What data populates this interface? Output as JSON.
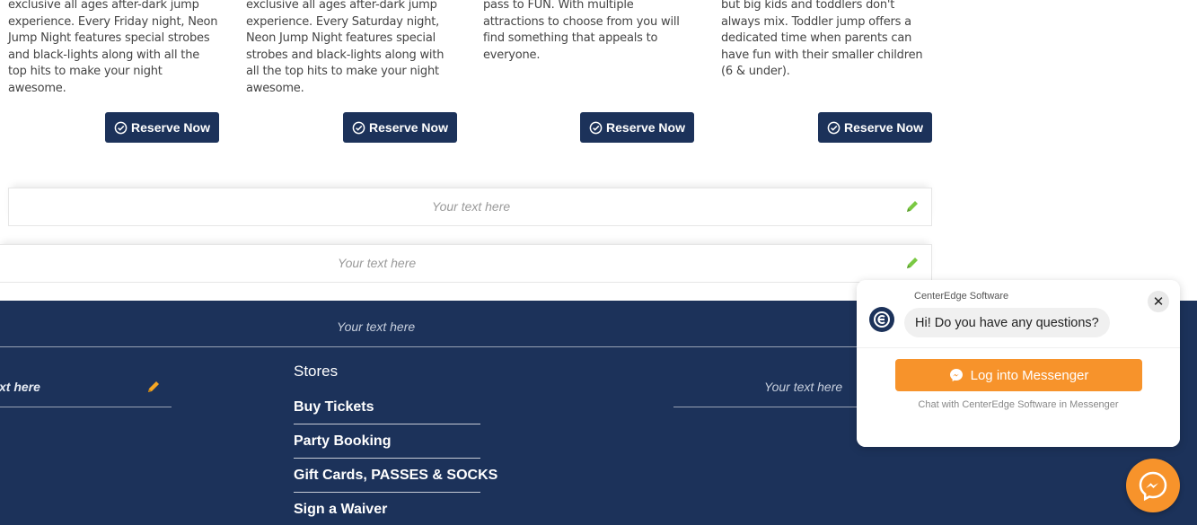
{
  "cards": [
    {
      "text": "exclusive all ages after-dark jump experience. Every Friday night, Neon Jump Night features special strobes and black-lights along with all the top hits to make your night awesome.",
      "button": "Reserve Now"
    },
    {
      "text": "exclusive all ages after-dark jump experience. Every Saturday night, Neon Jump Night features special strobes and black-lights along with all the top hits to make your night awesome.",
      "button": "Reserve Now"
    },
    {
      "text": "pass to FUN. With multiple attractions to choose from you will find something that appeals to everyone.",
      "button": "Reserve Now"
    },
    {
      "text": "but big kids and toddlers don't always mix. Toddler jump offers a dedicated time when parents can have fun with their smaller children (6 & under).",
      "button": "Reserve Now"
    }
  ],
  "placeholders": {
    "bar1": "Your text here",
    "bar2": "Your text here",
    "footer_top": "Your text here",
    "footer_left": "xt here",
    "footer_right": "Your text here"
  },
  "footer": {
    "stores_title": "Stores",
    "links": [
      "Buy Tickets",
      "Party Booking",
      "Gift Cards, PASSES & SOCKS",
      "Sign a Waiver"
    ]
  },
  "chat": {
    "company": "CenterEdge Software",
    "greeting": "Hi! Do you have any questions?",
    "close": "✕",
    "login_button": "Log into Messenger",
    "hint": "Chat with CenterEdge Software in Messenger"
  },
  "colors": {
    "navy": "#1c325a",
    "orange": "#f7932b",
    "pencil_green": "#7ac943",
    "pencil_orange": "#f5a623"
  },
  "icons": {
    "reserve": "check-circle-icon",
    "edit": "pencil-icon",
    "messenger": "messenger-icon",
    "close": "close-icon"
  }
}
